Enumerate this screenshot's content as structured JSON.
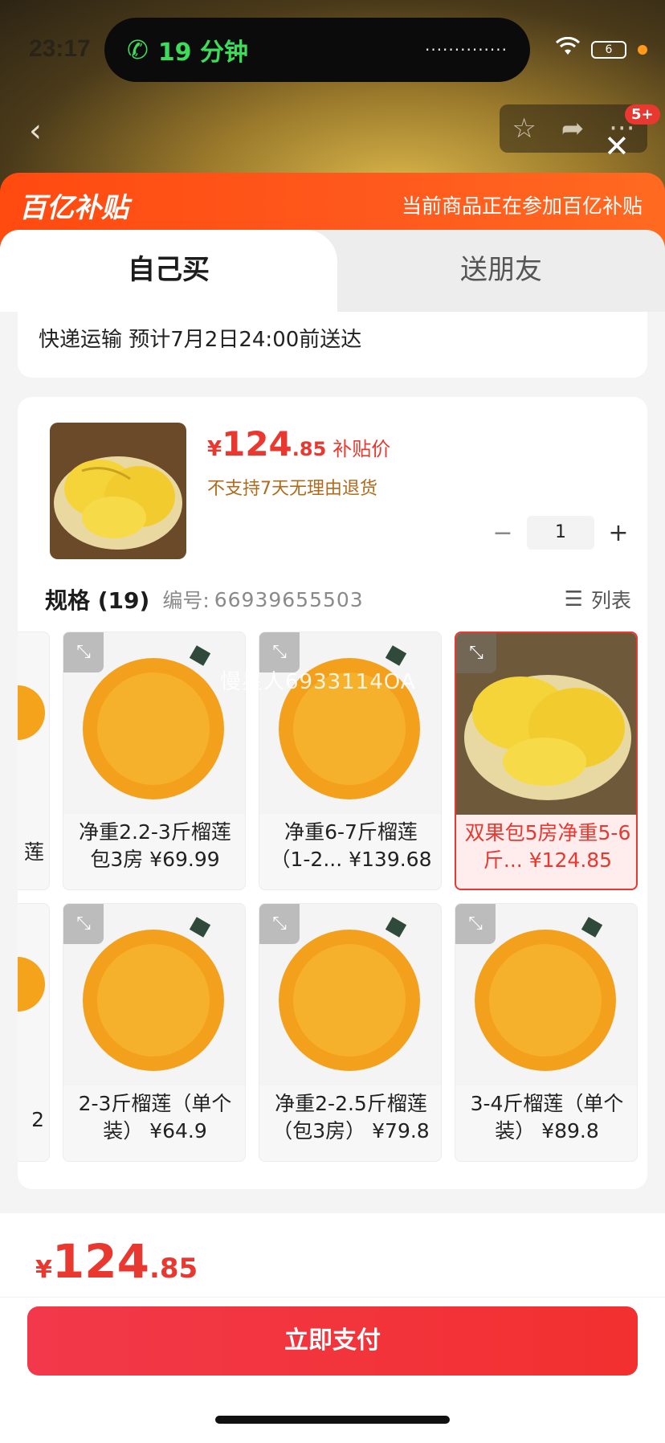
{
  "status_bar": {
    "time": "23:17",
    "call_duration": "19 分钟",
    "call_wave": "··············",
    "battery": "6"
  },
  "header": {
    "back_icon": "chevron-left-icon",
    "notification_badge": "5+"
  },
  "banner": {
    "logo": "百亿补贴",
    "notice": "当前商品正在参加百亿补贴"
  },
  "tabs": [
    {
      "label": "自己买",
      "active": true
    },
    {
      "label": "送朋友",
      "active": false
    }
  ],
  "delivery": {
    "text": "快递运输 预计7月2日24:00前送达"
  },
  "product": {
    "currency": "¥",
    "price_int": "124",
    "price_dec": ".85",
    "price_tag": "补贴价",
    "return_note": "不支持7天无理由退货",
    "quantity": "1",
    "minus": "−",
    "plus": "+"
  },
  "specs": {
    "title": "规格 (19)",
    "id_label": "编号:",
    "id_value": "66939655503",
    "list_label": "列表",
    "partial_row1": "莲",
    "partial_row2": "2",
    "variants": [
      {
        "label": "净重2.2-3斤榴莲包3房 ¥69.99",
        "selected": false,
        "image": "durian-whole"
      },
      {
        "label": "净重6-7斤榴莲（1-2... ¥139.68",
        "selected": false,
        "image": "durian-whole"
      },
      {
        "label": "双果包5房净重5-6斤... ¥124.85",
        "selected": true,
        "image": "durian-open"
      },
      {
        "label": "2-3斤榴莲（单个装） ¥64.9",
        "selected": false,
        "image": "durian-whole"
      },
      {
        "label": "净重2-2.5斤榴莲（包3房） ¥79.8",
        "selected": false,
        "image": "durian-whole"
      },
      {
        "label": "3-4斤榴莲（单个装） ¥89.8",
        "selected": false,
        "image": "durian-whole"
      }
    ]
  },
  "watermark": "慢星人6933114OA",
  "footer": {
    "currency": "¥",
    "total_int": "124",
    "total_dec": ".85",
    "pay_label": "立即支付"
  },
  "colors": {
    "accent": "#e8382f",
    "banner": "#ff4a10",
    "note": "#b06a1c"
  }
}
